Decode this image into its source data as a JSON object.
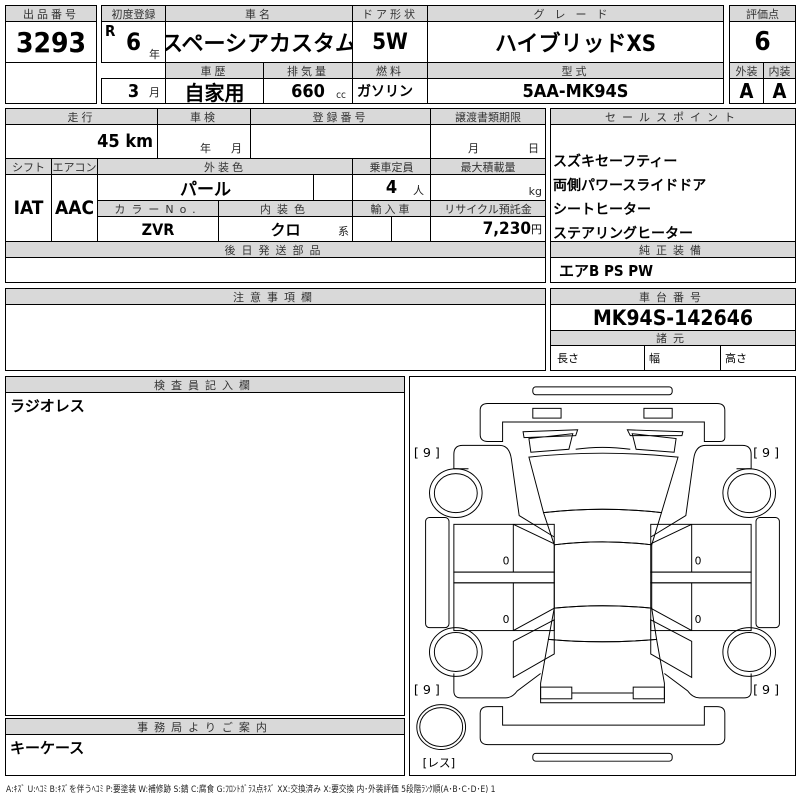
{
  "lot": {
    "label": "出品番号",
    "value": "3293"
  },
  "first_reg": {
    "label": "初度登録",
    "era": "R",
    "year": "6",
    "year_unit": "年",
    "month": "3",
    "month_unit": "月"
  },
  "car_name": {
    "label": "車名",
    "value": "スペーシアカスタム"
  },
  "door": {
    "label": "ドア形状",
    "value": "5W"
  },
  "grade": {
    "label": "グレード",
    "value": "ハイブリッドXS"
  },
  "history": {
    "label": "車歴",
    "value": "自家用"
  },
  "displacement": {
    "label": "排気量",
    "value": "660",
    "unit": "cc"
  },
  "fuel": {
    "label": "燃料",
    "value": "ガソリン"
  },
  "model": {
    "label": "型式",
    "value": "5AA-MK94S"
  },
  "score": {
    "label": "評価点",
    "value": "6",
    "ext_label": "外装",
    "int_label": "内装",
    "ext": "A",
    "int": "A"
  },
  "mileage": {
    "label": "走行",
    "value": "45",
    "unit": "km"
  },
  "inspection": {
    "label": "車検",
    "year_unit": "年",
    "month_unit": "月"
  },
  "reg_no": {
    "label": "登録番号"
  },
  "transfer": {
    "label": "譲渡書類期限",
    "month_unit": "月",
    "day_unit": "日"
  },
  "shift": {
    "label": "シフト",
    "value": "IAT"
  },
  "ac": {
    "label": "エアコン",
    "value": "AAC"
  },
  "ext_color": {
    "label": "外装色",
    "value": "パール"
  },
  "capacity": {
    "label": "乗車定員",
    "value": "4",
    "unit": "人"
  },
  "max_load": {
    "label": "最大積載量",
    "unit": "kg"
  },
  "color_no": {
    "label": "カラーNo.",
    "value": "ZVR"
  },
  "int_color": {
    "label": "内装色",
    "value": "クロ",
    "unit": "系"
  },
  "import": {
    "label": "輸入車"
  },
  "recycle": {
    "label": "リサイクル預託金",
    "value": "7,230",
    "unit": "円"
  },
  "later_parts": {
    "label": "後日発送部品"
  },
  "sales_points": {
    "label": "セールスポイント",
    "items": [
      "スズキセーフティー",
      "両側パワースライドドア",
      "シートヒーター",
      "ステアリングヒーター"
    ]
  },
  "equipment": {
    "label": "純正装備",
    "value": "エアB PS PW"
  },
  "notes": {
    "label": "注意事項欄"
  },
  "chassis": {
    "label": "車台番号",
    "value": "MK94S-142646",
    "spec_label": "諸元",
    "length": "長さ",
    "width": "幅",
    "height": "高さ"
  },
  "inspector": {
    "label": "検査員記入欄",
    "value": "ラジオレス"
  },
  "office": {
    "label": "事務局よりご案内",
    "value": "キーケース"
  },
  "diagram": {
    "tire_fl": "[ 9 ]",
    "tire_fr": "[ 9 ]",
    "tire_rl": "[ 9 ]",
    "tire_rr": "[ 9 ]",
    "spare": "[レス]",
    "mark": "0"
  },
  "legend": "A:ｷｽﾞ U:ﾍｺﾐ B:ｷｽﾞを伴うﾍｺﾐ P:要塗装 W:補修跡 S:錆 C:腐食 G:ﾌﾛﾝﾄｶﾞﾗｽ点ｷｽﾞ XX:交換済み X:要交換 内･外装評価 5段階ﾗﾝｸ順(A･B･C･D･E) 1"
}
